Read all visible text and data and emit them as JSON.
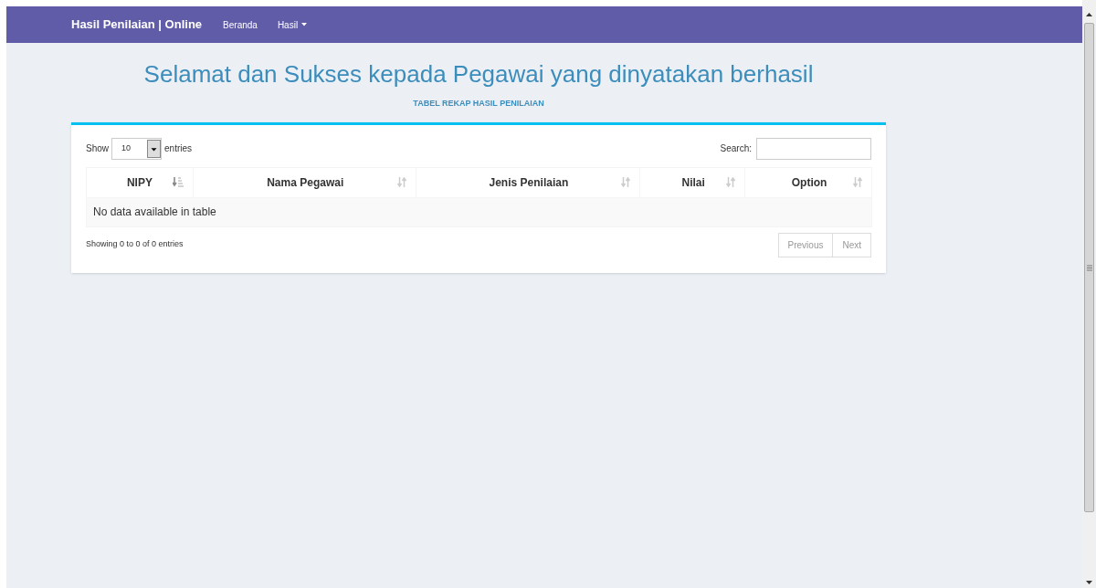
{
  "navbar": {
    "brand": "Hasil Penilaian | Online",
    "items": [
      {
        "label": "Beranda",
        "dropdown": false
      },
      {
        "label": "Hasil",
        "dropdown": true
      }
    ]
  },
  "heading": "Selamat dan Sukses kepada Pegawai yang dinyatakan berhasil",
  "subheading": "TABEL REKAP HASIL PENILAIAN",
  "length_menu": {
    "prefix": "Show",
    "value": "10",
    "suffix": "entries"
  },
  "search": {
    "label": "Search:"
  },
  "table": {
    "columns": [
      {
        "label": "NIPY",
        "sorted": true
      },
      {
        "label": "Nama Pegawai",
        "sorted": false
      },
      {
        "label": "Jenis Penilaian",
        "sorted": false
      },
      {
        "label": "Nilai",
        "sorted": false
      },
      {
        "label": "Option",
        "sorted": false
      }
    ],
    "empty_message": "No data available in table"
  },
  "info": "Showing 0 to 0 of 0 entries",
  "pagination": [
    {
      "label": "Previous",
      "disabled": true
    },
    {
      "label": "Next",
      "disabled": true
    }
  ]
}
